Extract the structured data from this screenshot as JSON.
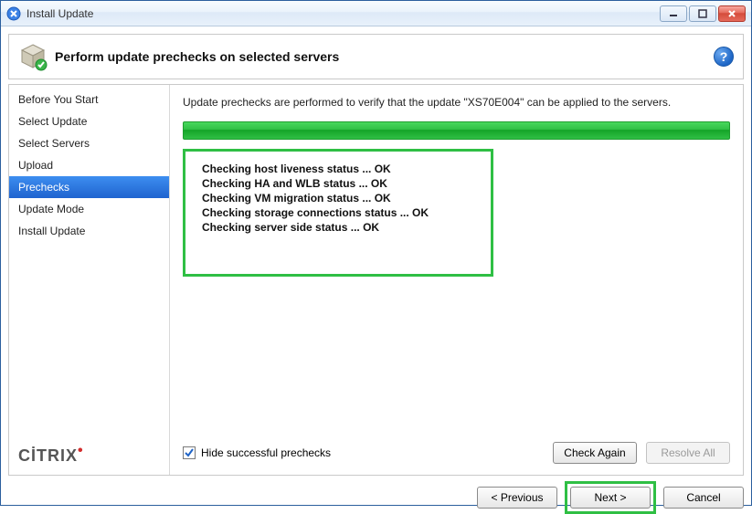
{
  "window": {
    "title": "Install Update"
  },
  "header": {
    "title": "Perform update prechecks on selected servers"
  },
  "sidebar": {
    "items": [
      {
        "label": "Before You Start"
      },
      {
        "label": "Select Update"
      },
      {
        "label": "Select Servers"
      },
      {
        "label": "Upload"
      },
      {
        "label": "Prechecks"
      },
      {
        "label": "Update Mode"
      },
      {
        "label": "Install Update"
      }
    ],
    "active_index": 4,
    "brand": "CİTRIX"
  },
  "main": {
    "description": "Update prechecks are performed to verify that the update \"XS70E004\" can be applied to the servers.",
    "results": [
      "Checking host liveness status ... OK",
      "Checking HA and WLB status ... OK",
      "Checking VM migration status ... OK",
      "Checking storage connections status ... OK",
      "Checking server side status ... OK"
    ],
    "hide_prechecks_label": "Hide successful prechecks",
    "hide_prechecks_checked": true,
    "check_again_label": "Check Again",
    "resolve_all_label": "Resolve All"
  },
  "footer": {
    "previous_label": "< Previous",
    "next_label": "Next >",
    "cancel_label": "Cancel"
  }
}
